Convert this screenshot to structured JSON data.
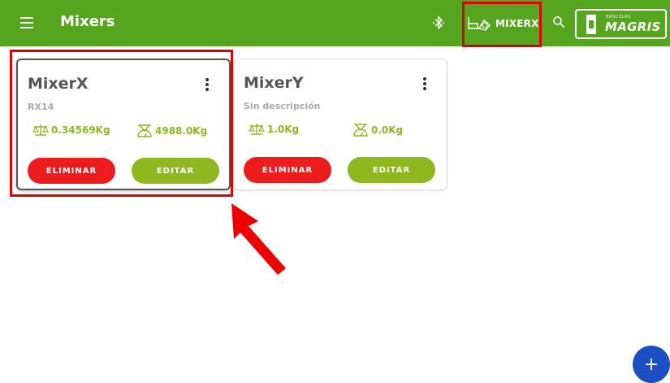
{
  "appbar": {
    "title": "Mixers",
    "selected_mixer": "MIXERX",
    "logo_small": "BÁSCULAS",
    "logo_text": "MAGRIS",
    "color": "#56a51e"
  },
  "cards": [
    {
      "name": "MixerX",
      "description": "RX14",
      "weight_1": "0.34569Kg",
      "weight_2": "4988.0Kg",
      "delete_label": "ELIMINAR",
      "edit_label": "EDITAR"
    },
    {
      "name": "MixerY",
      "description": "Sin descripción",
      "weight_1": "1.0Kg",
      "weight_2": "0.0Kg",
      "delete_label": "ELIMINAR",
      "edit_label": "EDITAR"
    }
  ],
  "fab": {
    "label": "+"
  },
  "icons": [
    "menu-icon",
    "bluetooth-icon",
    "mixer-truck-icon",
    "search-icon",
    "balance-scale-icon",
    "hanging-scale-icon",
    "more-vert-icon",
    "add-icon"
  ]
}
